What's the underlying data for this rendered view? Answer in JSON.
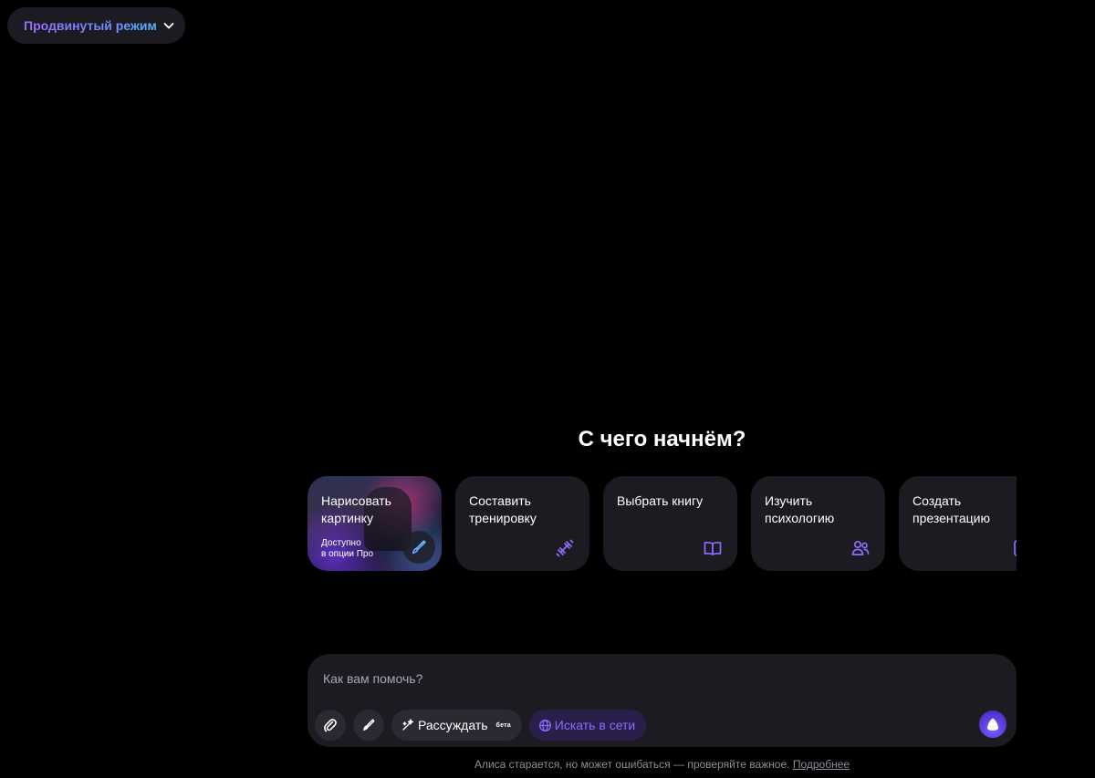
{
  "mode_selector": {
    "label": "Продвинутый режим"
  },
  "heading": "С чего начнём?",
  "suggestions": [
    {
      "label": "Нарисовать\nкартинку",
      "sublabel": "Доступно\nв опции Про",
      "icon": "brush-icon"
    },
    {
      "label": "Составить\nтренировку",
      "icon": "dumbbell-icon"
    },
    {
      "label": "Выбрать книгу",
      "icon": "book-icon"
    },
    {
      "label": "Изучить\nпсихологию",
      "icon": "people-icon"
    },
    {
      "label": "Создать\nпрезентацию",
      "icon": "presentation-icon"
    }
  ],
  "input": {
    "placeholder": "Как вам помочь?",
    "reason_label": "Рассуждать",
    "reason_badge": "бета",
    "search_label": "Искать в сети"
  },
  "footer": {
    "disclaimer": "Алиса старается, но может ошибаться — проверяйте важное.",
    "more_link": "Подробнее"
  },
  "colors": {
    "accent": "#8e6bff",
    "panel": "#1c1b22",
    "background": "#000000"
  }
}
